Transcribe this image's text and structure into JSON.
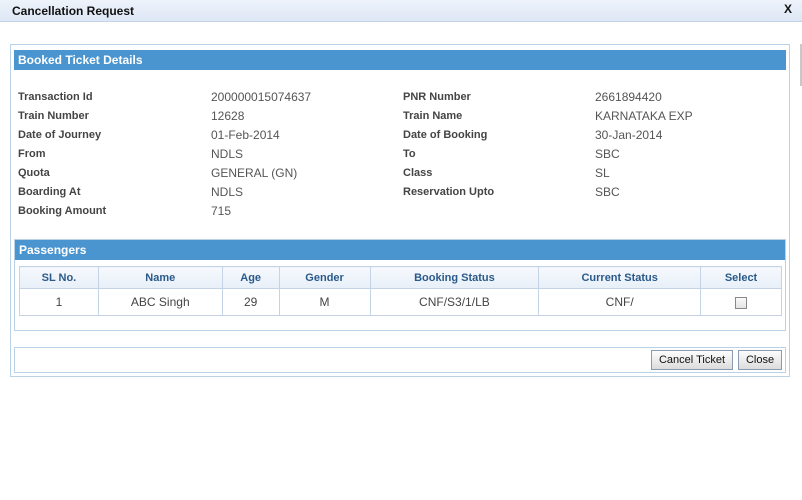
{
  "window": {
    "title": "Cancellation Request",
    "close_label": "X"
  },
  "booked": {
    "header": "Booked Ticket Details",
    "rows": [
      {
        "label1": "Transaction Id",
        "value1": "200000015074637",
        "label2": "PNR Number",
        "value2": "2661894420"
      },
      {
        "label1": "Train Number",
        "value1": "12628",
        "label2": "Train Name",
        "value2": "KARNATAKA EXP"
      },
      {
        "label1": "Date of Journey",
        "value1": "01-Feb-2014",
        "label2": "Date of Booking",
        "value2": "30-Jan-2014"
      },
      {
        "label1": "From",
        "value1": "NDLS",
        "label2": "To",
        "value2": "SBC"
      },
      {
        "label1": "Quota",
        "value1": "GENERAL (GN)",
        "label2": "Class",
        "value2": "SL"
      },
      {
        "label1": "Boarding At",
        "value1": "NDLS",
        "label2": "Reservation Upto",
        "value2": "SBC"
      },
      {
        "label1": "Booking Amount",
        "value1": "715",
        "label2": "",
        "value2": ""
      }
    ]
  },
  "passengers": {
    "header": "Passengers",
    "columns": [
      "SL No.",
      "Name",
      "Age",
      "Gender",
      "Booking Status",
      "Current Status",
      "Select"
    ],
    "rows": [
      {
        "sl": "1",
        "name": "ABC Singh",
        "age": "29",
        "gender": "M",
        "booking_status": "CNF/S3/1/LB",
        "current_status": "CNF/"
      }
    ]
  },
  "footer": {
    "cancel_label": "Cancel Ticket",
    "close_label": "Close"
  }
}
